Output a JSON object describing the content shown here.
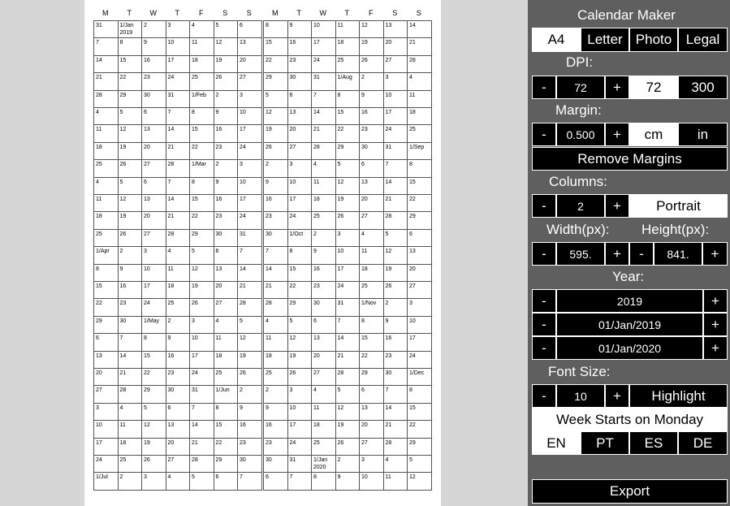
{
  "calendar": {
    "day_headers": [
      "M",
      "T",
      "W",
      "T",
      "F",
      "S",
      "S"
    ],
    "columns": [
      [
        [
          "31",
          "1/Jan\n2019",
          "2",
          "3",
          "4",
          "5",
          "6"
        ],
        [
          "7",
          "8",
          "9",
          "10",
          "11",
          "12",
          "13"
        ],
        [
          "14",
          "15",
          "16",
          "17",
          "18",
          "19",
          "20"
        ],
        [
          "21",
          "22",
          "23",
          "24",
          "25",
          "26",
          "27"
        ],
        [
          "28",
          "29",
          "30",
          "31",
          "1/Feb",
          "2",
          "3"
        ],
        [
          "4",
          "5",
          "6",
          "7",
          "8",
          "9",
          "10"
        ],
        [
          "11",
          "12",
          "13",
          "14",
          "15",
          "16",
          "17"
        ],
        [
          "18",
          "19",
          "20",
          "21",
          "22",
          "23",
          "24"
        ],
        [
          "25",
          "26",
          "27",
          "28",
          "1/Mar",
          "2",
          "3"
        ],
        [
          "4",
          "5",
          "6",
          "7",
          "8",
          "9",
          "10"
        ],
        [
          "11",
          "12",
          "13",
          "14",
          "15",
          "16",
          "17"
        ],
        [
          "18",
          "19",
          "20",
          "21",
          "22",
          "23",
          "24"
        ],
        [
          "25",
          "26",
          "27",
          "28",
          "29",
          "30",
          "31"
        ],
        [
          "1/Apr",
          "2",
          "3",
          "4",
          "5",
          "6",
          "7"
        ],
        [
          "8",
          "9",
          "10",
          "11",
          "12",
          "13",
          "14"
        ],
        [
          "15",
          "16",
          "17",
          "18",
          "19",
          "20",
          "21"
        ],
        [
          "22",
          "23",
          "24",
          "25",
          "26",
          "27",
          "28"
        ],
        [
          "29",
          "30",
          "1/May",
          "2",
          "3",
          "4",
          "5"
        ],
        [
          "6",
          "7",
          "8",
          "9",
          "10",
          "11",
          "12"
        ],
        [
          "13",
          "14",
          "15",
          "16",
          "17",
          "18",
          "19"
        ],
        [
          "20",
          "21",
          "22",
          "23",
          "24",
          "25",
          "26"
        ],
        [
          "27",
          "28",
          "29",
          "30",
          "31",
          "1/Jun",
          "2"
        ],
        [
          "3",
          "4",
          "5",
          "6",
          "7",
          "8",
          "9"
        ],
        [
          "10",
          "11",
          "12",
          "13",
          "14",
          "15",
          "16"
        ],
        [
          "17",
          "18",
          "19",
          "20",
          "21",
          "22",
          "23"
        ],
        [
          "24",
          "25",
          "26",
          "27",
          "28",
          "29",
          "30"
        ],
        [
          "1/Jul",
          "2",
          "3",
          "4",
          "5",
          "6",
          "7"
        ]
      ],
      [
        [
          "8",
          "9",
          "10",
          "11",
          "12",
          "13",
          "14"
        ],
        [
          "15",
          "16",
          "17",
          "18",
          "19",
          "20",
          "21"
        ],
        [
          "22",
          "23",
          "24",
          "25",
          "26",
          "27",
          "28"
        ],
        [
          "29",
          "30",
          "31",
          "1/Aug",
          "2",
          "3",
          "4"
        ],
        [
          "5",
          "6",
          "7",
          "8",
          "9",
          "10",
          "11"
        ],
        [
          "12",
          "13",
          "14",
          "15",
          "16",
          "17",
          "18"
        ],
        [
          "19",
          "20",
          "21",
          "22",
          "23",
          "24",
          "25"
        ],
        [
          "26",
          "27",
          "28",
          "29",
          "30",
          "31",
          "1/Sep"
        ],
        [
          "2",
          "3",
          "4",
          "5",
          "6",
          "7",
          "8"
        ],
        [
          "9",
          "10",
          "11",
          "12",
          "13",
          "14",
          "15"
        ],
        [
          "16",
          "17",
          "18",
          "19",
          "20",
          "21",
          "22"
        ],
        [
          "23",
          "24",
          "25",
          "26",
          "27",
          "28",
          "29"
        ],
        [
          "30",
          "1/Oct",
          "2",
          "3",
          "4",
          "5",
          "6"
        ],
        [
          "7",
          "8",
          "9",
          "10",
          "11",
          "12",
          "13"
        ],
        [
          "14",
          "15",
          "16",
          "17",
          "18",
          "19",
          "20"
        ],
        [
          "21",
          "22",
          "23",
          "24",
          "25",
          "26",
          "27"
        ],
        [
          "28",
          "29",
          "30",
          "31",
          "1/Nov",
          "2",
          "3"
        ],
        [
          "4",
          "5",
          "6",
          "7",
          "8",
          "9",
          "10"
        ],
        [
          "11",
          "12",
          "13",
          "14",
          "15",
          "16",
          "17"
        ],
        [
          "18",
          "19",
          "20",
          "21",
          "22",
          "23",
          "24"
        ],
        [
          "25",
          "26",
          "27",
          "28",
          "29",
          "30",
          "1/Dec"
        ],
        [
          "2",
          "3",
          "4",
          "5",
          "6",
          "7",
          "8"
        ],
        [
          "9",
          "10",
          "11",
          "12",
          "13",
          "14",
          "15"
        ],
        [
          "16",
          "17",
          "18",
          "19",
          "20",
          "21",
          "22"
        ],
        [
          "23",
          "24",
          "25",
          "26",
          "27",
          "28",
          "29"
        ],
        [
          "30",
          "31",
          "1/Jan\n2020",
          "2",
          "3",
          "4",
          "5"
        ],
        [
          "6",
          "7",
          "8",
          "9",
          "10",
          "11",
          "12"
        ]
      ]
    ]
  },
  "panel": {
    "title": "Calendar Maker",
    "paper_sizes": [
      "A4",
      "Letter",
      "Photo",
      "Legal"
    ],
    "dpi_label": "DPI:",
    "dpi_value": "72",
    "dpi_preset_1": "72",
    "dpi_preset_2": "300",
    "margin_label": "Margin:",
    "margin_value": "0.500",
    "unit_cm": "cm",
    "unit_in": "in",
    "remove_margins": "Remove Margins",
    "columns_label": "Columns:",
    "columns_value": "2",
    "orientation": "Portrait",
    "width_label": "Width(px):",
    "height_label": "Height(px):",
    "width_value": "595.",
    "height_value": "841.",
    "year_label": "Year:",
    "year_value": "2019",
    "start_date": "01/Jan/2019",
    "end_date": "01/Jan/2020",
    "font_size_label": "Font Size:",
    "font_size_value": "10",
    "highlight": "Highlight",
    "week_start": "Week Starts on Monday",
    "languages": [
      "EN",
      "PT",
      "ES",
      "DE"
    ],
    "export": "Export",
    "minus": "-",
    "plus": "+"
  }
}
